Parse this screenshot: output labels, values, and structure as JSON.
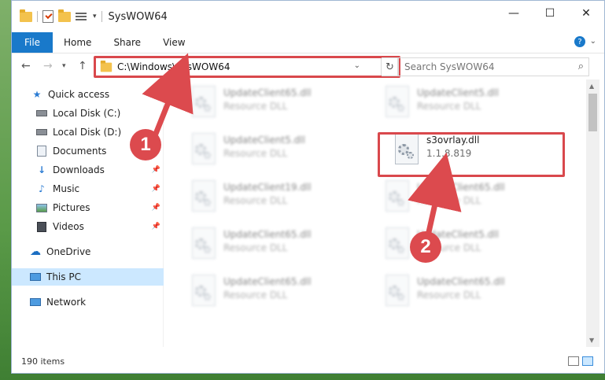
{
  "window": {
    "title": "SysWOW64",
    "controls": {
      "minimize": "—",
      "maximize": "☐",
      "close": "✕"
    }
  },
  "ribbon": {
    "tabs": [
      "File",
      "Home",
      "Share",
      "View"
    ],
    "help": "?"
  },
  "address": {
    "path": "C:\\Windows\\SysWOW64",
    "search_placeholder": "Search SysWOW64"
  },
  "sidebar": {
    "items": [
      {
        "label": "Quick access",
        "icon": "star-icon",
        "pinned": false
      },
      {
        "label": "Local Disk (C:)",
        "icon": "drive-icon",
        "pinned": false
      },
      {
        "label": "Local Disk (D:)",
        "icon": "drive-icon",
        "pinned": false
      },
      {
        "label": "Documents",
        "icon": "documents-icon",
        "pinned": false
      },
      {
        "label": "Downloads",
        "icon": "download-icon",
        "pinned": true
      },
      {
        "label": "Music",
        "icon": "music-icon",
        "pinned": true
      },
      {
        "label": "Pictures",
        "icon": "pictures-icon",
        "pinned": true
      },
      {
        "label": "Videos",
        "icon": "videos-icon",
        "pinned": true
      },
      {
        "label": "OneDrive",
        "icon": "cloud-icon",
        "pinned": false
      },
      {
        "label": "This PC",
        "icon": "computer-icon",
        "pinned": false,
        "selected": true
      },
      {
        "label": "Network",
        "icon": "network-icon",
        "pinned": false
      }
    ]
  },
  "files": [
    {
      "name": "UpdateClient65.dll",
      "sub": "Resource DLL",
      "blurred": true
    },
    {
      "name": "UpdateClient5.dll",
      "sub": "Resource DLL",
      "blurred": true
    },
    {
      "name": "UpdateClient5.dll",
      "sub": "Resource DLL",
      "blurred": true
    },
    {
      "name": "s3ovrlay.dll",
      "sub": "1.1.8.819",
      "blurred": false
    },
    {
      "name": "UpdateClient19.dll",
      "sub": "Resource DLL",
      "blurred": true
    },
    {
      "name": "UpdateClient65.dll",
      "sub": "Resource DLL",
      "blurred": true
    },
    {
      "name": "UpdateClient65.dll",
      "sub": "Resource DLL",
      "blurred": true
    },
    {
      "name": "UpdateClient5.dll",
      "sub": "Resource DLL",
      "blurred": true
    },
    {
      "name": "UpdateClient65.dll",
      "sub": "Resource DLL",
      "blurred": true
    },
    {
      "name": "UpdateClient65.dll",
      "sub": "Resource DLL",
      "blurred": true
    }
  ],
  "status": {
    "item_count": "190 items"
  },
  "annotations": {
    "step1": "1",
    "step2": "2"
  },
  "colors": {
    "accent": "#1979ca",
    "highlight": "#d9484c",
    "selection": "#cce8ff"
  }
}
